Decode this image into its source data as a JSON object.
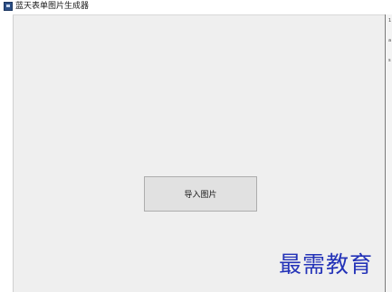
{
  "window": {
    "title": "蓝天表单图片生成器",
    "icon": "app-icon"
  },
  "main": {
    "import_button_label": "导入图片"
  },
  "right_panel": {
    "marks": [
      "1",
      "a",
      "s"
    ]
  },
  "watermark": {
    "text": "最需教育",
    "color": "#2433b8"
  }
}
